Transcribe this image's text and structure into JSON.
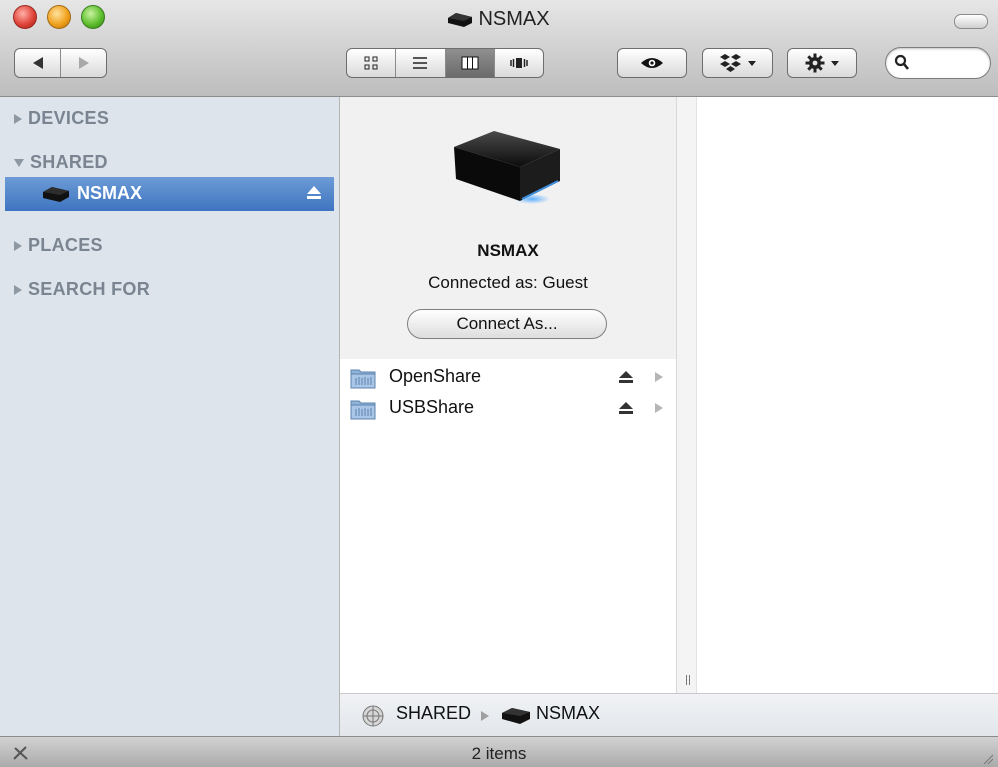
{
  "window": {
    "title": "NSMAX"
  },
  "toolbar": {
    "nav": {
      "back_icon": "chevron-left-icon",
      "forward_icon": "chevron-right-icon"
    },
    "view_modes": [
      {
        "name": "icon-view",
        "active": false
      },
      {
        "name": "list-view",
        "active": false
      },
      {
        "name": "column-view",
        "active": true
      },
      {
        "name": "cover-flow-view",
        "active": false
      }
    ],
    "quicklook_icon": "eye-icon",
    "dropbox_icon": "dropbox-icon",
    "action_icon": "gear-icon",
    "search": {
      "placeholder": "",
      "value": ""
    }
  },
  "sidebar": {
    "sections": [
      {
        "label": "DEVICES",
        "expanded": false
      },
      {
        "label": "SHARED",
        "expanded": true
      },
      {
        "label": "PLACES",
        "expanded": false
      },
      {
        "label": "SEARCH FOR",
        "expanded": false
      }
    ],
    "selected_item": {
      "label": "NSMAX",
      "icon": "network-drive-icon",
      "eject_icon": "eject-icon"
    }
  },
  "preview": {
    "name": "NSMAX",
    "status": "Connected as: Guest",
    "connect_button": "Connect As..."
  },
  "shares": [
    {
      "name": "OpenShare",
      "icon": "shared-folder-icon"
    },
    {
      "name": "USBShare",
      "icon": "shared-folder-icon"
    }
  ],
  "pathbar": {
    "items": [
      "SHARED",
      "NSMAX"
    ]
  },
  "status": {
    "text": "2 items"
  },
  "colors": {
    "selection": "#3e74c0",
    "sidebar_bg": "#dde4ec",
    "section_text": "#7a8591"
  }
}
